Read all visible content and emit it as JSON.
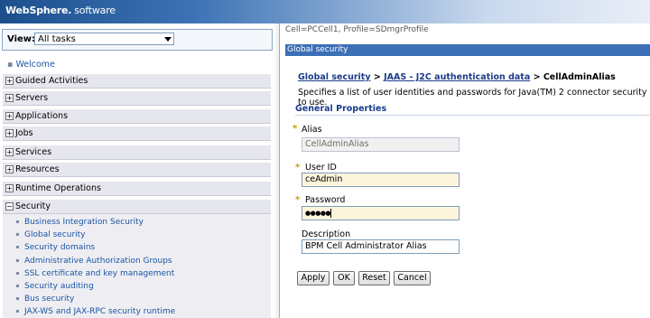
{
  "banner": {
    "brand": "WebSphere.",
    "product": "software"
  },
  "nav": {
    "view_label": "View:",
    "view_value": "All tasks",
    "welcome": "Welcome",
    "categories": [
      {
        "label": "Guided Activities",
        "expanded": false
      },
      {
        "label": "Servers",
        "expanded": false
      },
      {
        "label": "Applications",
        "expanded": false
      },
      {
        "label": "Jobs",
        "expanded": false
      },
      {
        "label": "Services",
        "expanded": false
      },
      {
        "label": "Resources",
        "expanded": false
      },
      {
        "label": "Runtime Operations",
        "expanded": false
      },
      {
        "label": "Security",
        "expanded": true
      }
    ],
    "security_items": [
      "Business Integration Security",
      "Global security",
      "Security domains",
      "Administrative Authorization Groups",
      "SSL certificate and key management",
      "Security auditing",
      "Bus security",
      "JAX-WS and JAX-RPC security runtime"
    ]
  },
  "content": {
    "cell_info": "Cell=PCCell1, Profile=SDmgrProfile",
    "panel_title": "Global security",
    "breadcrumb": {
      "link1": "Global security",
      "sep": " > ",
      "link2": "JAAS - J2C authentication data",
      "current": " > CellAdminAlias"
    },
    "description": "Specifies a list of user identities and passwords for Java(TM) 2 connector security to use.",
    "section_title": "General Properties",
    "fields": {
      "alias_label": "Alias",
      "alias_value": "CellAdminAlias",
      "userid_label": "User ID",
      "userid_value": "ceAdmin",
      "password_label": "Password",
      "password_value": "●●●●●",
      "description_label": "Description",
      "description_value": "BPM Cell Administrator Alias"
    },
    "buttons": {
      "apply": "Apply",
      "ok": "OK",
      "reset": "Reset",
      "cancel": "Cancel"
    }
  },
  "colors": {
    "accent": "#3d6fb6",
    "link": "#1a55a3",
    "required": "#c8a000"
  }
}
